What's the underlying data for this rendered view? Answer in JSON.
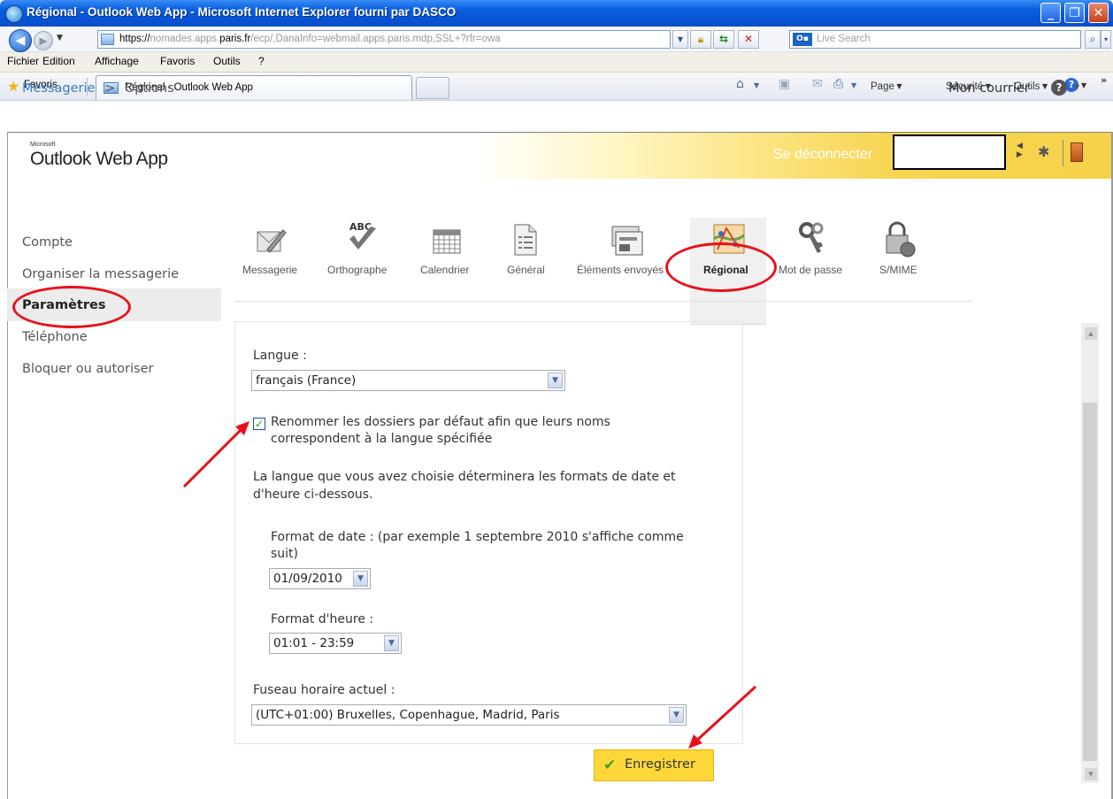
{
  "window": {
    "title": "Régional - Outlook Web App - Microsoft Internet Explorer fourni par DASCO",
    "min": "_",
    "max": "❐",
    "close": "✕"
  },
  "address": {
    "protocol": "https://",
    "pre": "nomades.apps.",
    "domain": "paris.fr",
    "path": "/ecp/,DanaInfo=webmail.apps.paris.mdp,SSL+?rfr=owa"
  },
  "search": {
    "placeholder": "Live Search"
  },
  "menu": [
    "Fichier",
    "Edition",
    "Affichage",
    "Favoris",
    "Outils",
    "?"
  ],
  "favorites": {
    "label": "Favoris",
    "tab_title": "Régional - Outlook Web App"
  },
  "commands": {
    "page": "Page",
    "security": "Sécurité",
    "tools": "Outils"
  },
  "owa": {
    "ms_label": "Microsoft",
    "logo": "Outlook Web App",
    "logout": "Se déconnecter",
    "breadcrumb": {
      "mail": "Messagerie",
      "sep": ">",
      "options": "Options"
    },
    "my_mail": "Mon courrier",
    "nav": [
      "Compte",
      "Organiser la messagerie",
      "Paramètres",
      "Téléphone",
      "Bloquer ou autoriser"
    ],
    "tabs": [
      "Messagerie",
      "Orthographe",
      "Calendrier",
      "Général",
      "Éléments envoyés",
      "Régional",
      "Mot de passe",
      "S/MIME"
    ],
    "selected_tab": "Régional"
  },
  "form": {
    "language_label": "Langue :",
    "language_value": "français (France)",
    "rename_checked": true,
    "rename_line1": "Renommer les dossiers par défaut afin que leurs noms",
    "rename_line2": "correspondent à la langue spécifiée",
    "info_line1": "La langue que vous avez choisie déterminera les formats de date et",
    "info_line2": "d'heure ci-dessous.",
    "date_label_line1": "Format de date : (par exemple 1 septembre 2010 s'affiche comme",
    "date_label_line2": "suit)",
    "date_value": "01/09/2010",
    "time_label": "Format d'heure :",
    "time_value": "01:01 - 23:59",
    "tz_label": "Fuseau horaire actuel :",
    "tz_value": "(UTC+01:00) Bruxelles, Copenhague, Madrid, Paris",
    "save_label": "Enregistrer"
  },
  "colors": {
    "accent_link": "#3a7dc8",
    "save_button": "#ffd739",
    "annotation": "#e8111a",
    "xp_titlebar": "#0a5fe0"
  }
}
